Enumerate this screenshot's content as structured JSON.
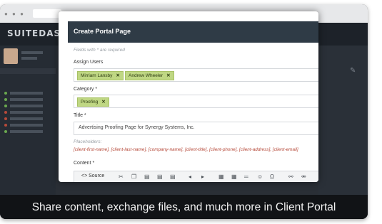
{
  "app": {
    "logo": "SUITEDASH"
  },
  "modal": {
    "title": "Create Portal Page",
    "required_note": "Fields with * are required",
    "assign_users": {
      "label": "Assign Users",
      "tags": [
        "Mirriam Lansby",
        "Andrew Wheeler"
      ]
    },
    "category": {
      "label": "Category *",
      "tags": [
        "Proofing"
      ]
    },
    "title_field": {
      "label": "Title *",
      "value": "Advertising Proofing Page for Synergy Systems, Inc."
    },
    "placeholders": {
      "label": "Placeholders:",
      "items": "[client-first-name], [client-last-name], [company-name], [client-title], [client-phone], [client-address], [client-email]"
    },
    "content": {
      "label": "Content *",
      "source_button": "Source"
    },
    "tag_remove_glyph": "✕"
  },
  "icons": [
    "close-icon",
    "cut-icon",
    "copy-icon",
    "paste-icon",
    "paste-text-icon",
    "paste-word-icon",
    "undo-icon",
    "redo-icon",
    "image-icon",
    "table-icon",
    "horizontal-line-icon",
    "smiley-icon",
    "special-char-icon",
    "link-icon",
    "unlink-icon",
    "pencil-icon"
  ],
  "caption": "Share content, exchange files, and much more in Client Portal",
  "colors": {
    "tag_bg": "#bfd783",
    "header_bg": "#2f3b46",
    "placeholder_text": "#b64a3a"
  }
}
